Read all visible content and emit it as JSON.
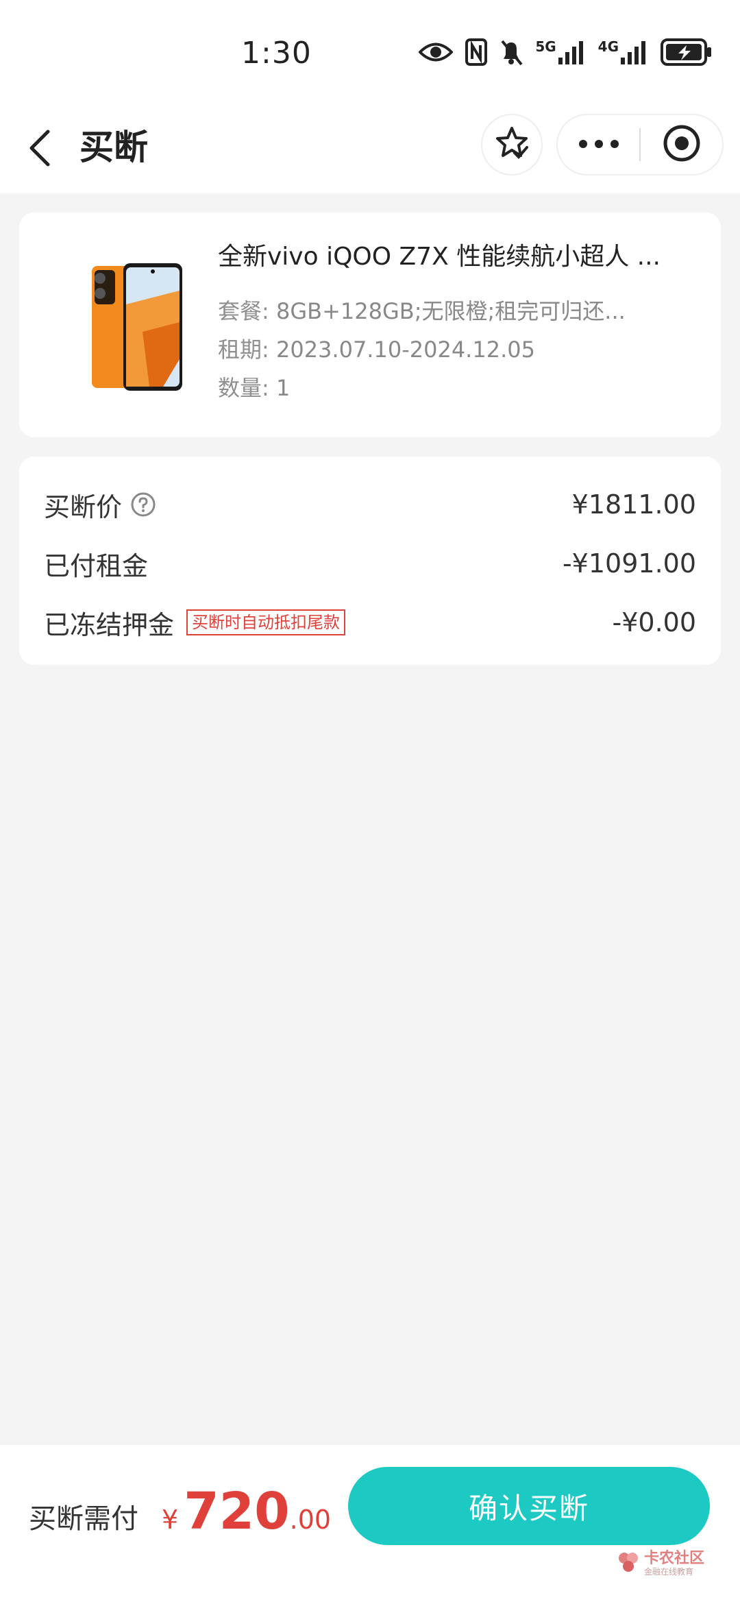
{
  "status_bar": {
    "time": "1:30",
    "net1": "5G",
    "net2": "4G"
  },
  "nav": {
    "title": "买断"
  },
  "product": {
    "title": "全新vivo iQOO Z7X 性能续航小超人 ...",
    "package_label": "套餐:",
    "package_value": "8GB+128GB;无限橙;租完可归还...",
    "period_label": "租期:",
    "period_value": "2023.07.10-2024.12.05",
    "qty_label": "数量:",
    "qty_value": "1"
  },
  "prices": {
    "buyout_label": "买断价",
    "buyout_value": "¥1811.00",
    "paid_label": "已付租金",
    "paid_value": "-¥1091.00",
    "deposit_label": "已冻结押金",
    "deposit_tag": "买断时自动抵扣尾款",
    "deposit_value": "-¥0.00"
  },
  "bottom": {
    "pay_label": "买断需付",
    "currency": "¥",
    "amount_int": "720",
    "amount_dec": ".00",
    "confirm_label": "确认买断"
  },
  "watermark": {
    "title": "卡农社区",
    "sub": "金融在线教育"
  },
  "colors": {
    "accent": "#1ccac3",
    "price_red": "#e0403a",
    "product_orange": "#f28a1e"
  }
}
